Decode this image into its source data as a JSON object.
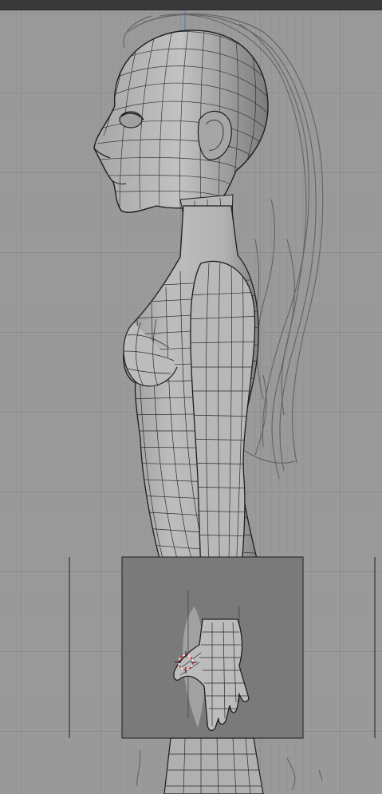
{
  "viewport": {
    "view": "side",
    "grid": true,
    "colors": {
      "background": "#9a9a9a",
      "grid_minor": "#8e8e8e",
      "grid_major": "#7f7f7f",
      "mesh_fill": "#b4b4b4",
      "mesh_shade": "#8c8c8c",
      "wire": "#2b2b2b",
      "sketch": "#5e5e5e",
      "panel_fill": "#7a7a7a",
      "panel_border": "#1e1e1e",
      "axis_line": "#4a78b8",
      "cursor": "#d42020"
    },
    "objects": [
      {
        "name": "character-mesh",
        "kind": "mesh",
        "shading": "solid-wireframe"
      },
      {
        "name": "hair-reference-sketch",
        "kind": "image-reference"
      },
      {
        "name": "hand-reference-plane",
        "kind": "image-plane"
      }
    ],
    "cursor_3d": {
      "visible": true,
      "icon": "3d-cursor-icon"
    }
  }
}
